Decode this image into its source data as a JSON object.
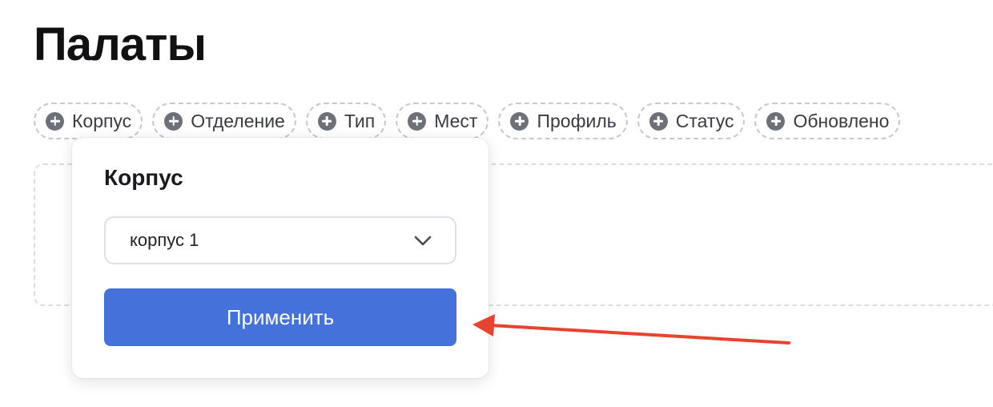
{
  "page": {
    "title": "Палаты"
  },
  "filters": [
    {
      "label": "Корпус",
      "icon": "plus-circle-icon"
    },
    {
      "label": "Отделение",
      "icon": "plus-circle-icon"
    },
    {
      "label": "Тип",
      "icon": "plus-circle-icon"
    },
    {
      "label": "Мест",
      "icon": "plus-circle-icon"
    },
    {
      "label": "Профиль",
      "icon": "plus-circle-icon"
    },
    {
      "label": "Статус",
      "icon": "plus-circle-icon"
    },
    {
      "label": "Обновлено",
      "icon": "plus-circle-icon"
    }
  ],
  "popover": {
    "title": "Корпус",
    "select": {
      "value": "корпус 1",
      "icon": "chevron-down-icon"
    },
    "apply_label": "Применить"
  },
  "colors": {
    "accent": "#4572da",
    "annotation_arrow": "#e8432f",
    "chip_icon": "#6e7079",
    "chip_border": "#c7c9d0"
  }
}
